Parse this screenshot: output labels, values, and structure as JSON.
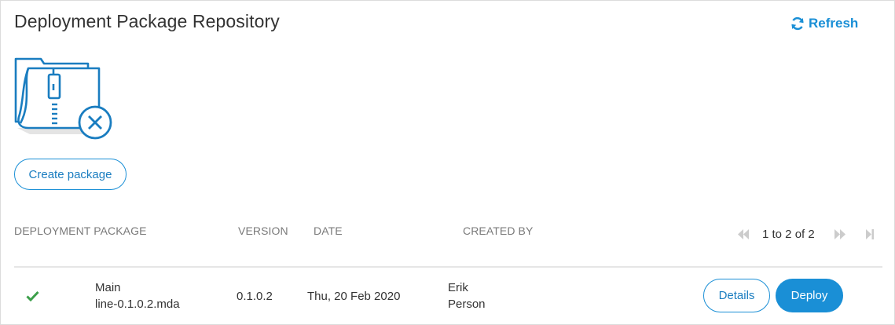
{
  "header": {
    "title": "Deployment Package Repository",
    "refresh_label": "Refresh"
  },
  "actions": {
    "create_label": "Create package"
  },
  "table": {
    "columns": [
      "DEPLOYMENT PACKAGE",
      "VERSION",
      "DATE",
      "CREATED BY"
    ],
    "pagination": {
      "text": "1 to 2 of 2"
    },
    "rows": [
      {
        "status": "success",
        "package_line1": "Main",
        "package_line2": "line-0.1.0.2.mda",
        "version": "0.1.0.2",
        "date": "Thu, 20 Feb 2020",
        "created_by_line1": "Erik",
        "created_by_line2": "Person",
        "details_label": "Details",
        "deploy_label": "Deploy"
      }
    ]
  },
  "colors": {
    "accent": "#1a8fd6",
    "success": "#3c9f4a",
    "illustration": "#1a7dc0"
  }
}
